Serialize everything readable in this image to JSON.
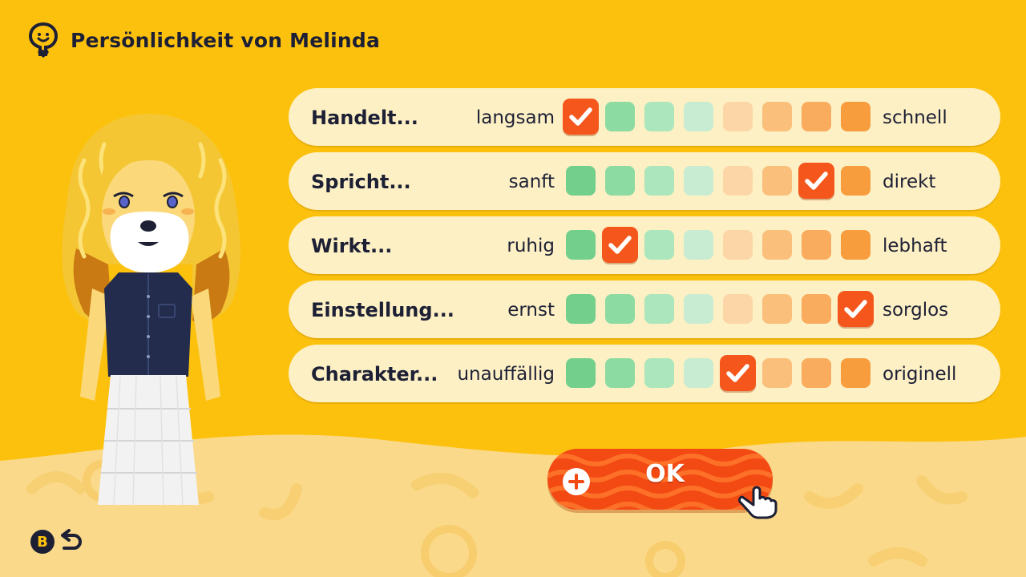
{
  "header": {
    "title": "Persönlichkeit von Melinda"
  },
  "cell_colors": [
    "#72cf8c",
    "#8cdba2",
    "#ace6bd",
    "#c8ecd2",
    "#fcd6a7",
    "#fbbf7c",
    "#f9ac5e",
    "#f79d3d"
  ],
  "rows": [
    {
      "label": "Handelt...",
      "left": "langsam",
      "right": "schnell",
      "selected": 0
    },
    {
      "label": "Spricht...",
      "left": "sanft",
      "right": "direkt",
      "selected": 6
    },
    {
      "label": "Wirkt...",
      "left": "ruhig",
      "right": "lebhaft",
      "selected": 1
    },
    {
      "label": "Einstellung...",
      "left": "ernst",
      "right": "sorglos",
      "selected": 7
    },
    {
      "label": "Charakter...",
      "left": "unauffällig",
      "right": "originell",
      "selected": 4
    }
  ],
  "ok_button": {
    "label": "OK",
    "icon": "plus-icon"
  },
  "back_hint": {
    "button_letter": "B",
    "icon": "back-arrow-icon"
  },
  "colors": {
    "background": "#fcc10d",
    "accent": "#f4561b",
    "text": "#1d2035"
  }
}
